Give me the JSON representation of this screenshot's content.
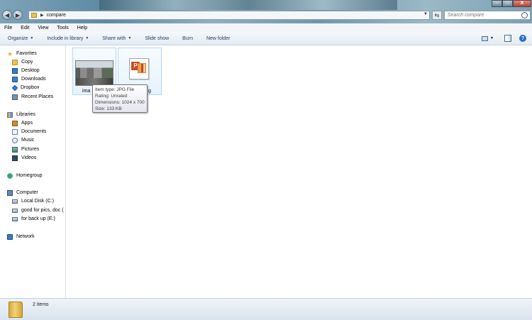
{
  "window": {
    "breadcrumb": "compare",
    "search_placeholder": "Search compare",
    "minimize": "–",
    "maximize": "□",
    "close": "X"
  },
  "menu": [
    "File",
    "Edit",
    "View",
    "Tools",
    "Help"
  ],
  "toolbar": {
    "organize": "Organize",
    "include_in_library": "Include in library",
    "share_with": "Share with",
    "slide_show": "Slide show",
    "burn": "Burn",
    "new_folder": "New folder"
  },
  "sidebar": {
    "favorites": "Favorites",
    "favorites_items": [
      "Copy",
      "Desktop",
      "Downloads",
      "Dropbox",
      "Recent Places"
    ],
    "libraries": "Libraries",
    "libraries_items": [
      "Apps",
      "Documents",
      "Music",
      "Pictures",
      "Videos"
    ],
    "homegroup": "Homegroup",
    "computer": "Computer",
    "computer_items": [
      "Local Disk (C:)",
      "good  for pics, doc (",
      "for back up  (E:)"
    ],
    "network": "Network"
  },
  "files": [
    {
      "label": "ima",
      "type": "image"
    },
    {
      "label": "g",
      "type": "powerpoint"
    }
  ],
  "tooltip": {
    "item_type": "Item type: JPG File",
    "rating": "Rating: Unrated",
    "dimensions": "Dimensions: 1024 x 700",
    "size": "Size: 133 KB"
  },
  "status": {
    "item_count": "2 items"
  },
  "colors": {
    "toolbar_text": "#1e395b",
    "selection_border": "#b9d6f2",
    "close_button": "#c13c28"
  }
}
